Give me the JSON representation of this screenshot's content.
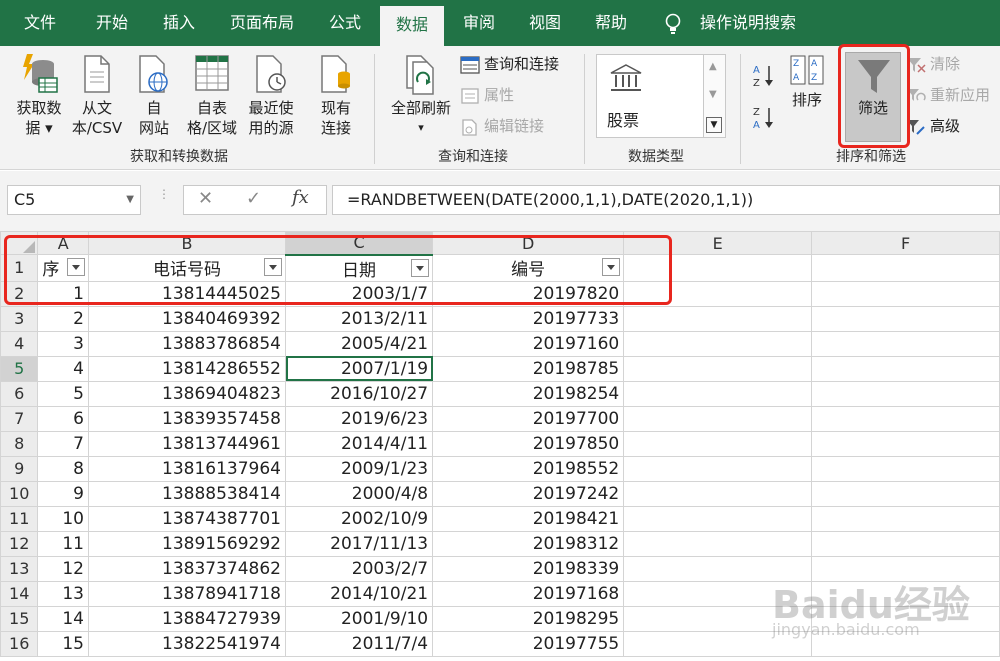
{
  "tabs": [
    {
      "label": "文件"
    },
    {
      "label": "开始"
    },
    {
      "label": "插入"
    },
    {
      "label": "页面布局"
    },
    {
      "label": "公式"
    },
    {
      "label": "数据"
    },
    {
      "label": "审阅"
    },
    {
      "label": "视图"
    },
    {
      "label": "帮助"
    },
    {
      "label": "操作说明搜索"
    }
  ],
  "active_tab": "数据",
  "ribbon": {
    "get_data": {
      "line1": "获取数",
      "line2": "据 ▾"
    },
    "from_csv": {
      "line1": "从文",
      "line2": "本/CSV"
    },
    "from_web": {
      "line1": "自",
      "line2": "网站"
    },
    "from_table": {
      "line1": "自表",
      "line2": "格/区域"
    },
    "recent_sources": {
      "line1": "最近使",
      "line2": "用的源"
    },
    "existing_conn": {
      "line1": "现有",
      "line2": "连接"
    },
    "group1_label": "获取和转换数据",
    "refresh_all": {
      "line1": "全部刷新",
      "line2": "▾"
    },
    "queries_connections": "查询和连接",
    "properties": "属性",
    "edit_links": "编辑链接",
    "group2_label": "查询和连接",
    "stocks": "股票",
    "group3_label": "数据类型",
    "sort": "排序",
    "filter": "筛选",
    "clear": "清除",
    "reapply": "重新应用",
    "advanced": "高级",
    "group4_label": "排序和筛选"
  },
  "formula_bar": {
    "name_box": "C5",
    "fx": "fx",
    "formula": "=RANDBETWEEN(DATE(2000,1,1),DATE(2020,1,1))"
  },
  "sheet": {
    "columns": [
      "A",
      "B",
      "C",
      "D",
      "E",
      "F"
    ],
    "header_row": {
      "a": "序",
      "b": "电话号码",
      "c": "日期",
      "d": "编号"
    },
    "rows": [
      {
        "n": "2",
        "a": "1",
        "b": "13814445025",
        "c": "2003/1/7",
        "d": "20197820"
      },
      {
        "n": "3",
        "a": "2",
        "b": "13840469392",
        "c": "2013/2/11",
        "d": "20197733"
      },
      {
        "n": "4",
        "a": "3",
        "b": "13883786854",
        "c": "2005/4/21",
        "d": "20197160"
      },
      {
        "n": "5",
        "a": "4",
        "b": "13814286552",
        "c": "2007/1/19",
        "d": "20198785"
      },
      {
        "n": "6",
        "a": "5",
        "b": "13869404823",
        "c": "2016/10/27",
        "d": "20198254"
      },
      {
        "n": "7",
        "a": "6",
        "b": "13839357458",
        "c": "2019/6/23",
        "d": "20197700"
      },
      {
        "n": "8",
        "a": "7",
        "b": "13813744961",
        "c": "2014/4/11",
        "d": "20197850"
      },
      {
        "n": "9",
        "a": "8",
        "b": "13816137964",
        "c": "2009/1/23",
        "d": "20198552"
      },
      {
        "n": "10",
        "a": "9",
        "b": "13888538414",
        "c": "2000/4/8",
        "d": "20197242"
      },
      {
        "n": "11",
        "a": "10",
        "b": "13874387701",
        "c": "2002/10/9",
        "d": "20198421"
      },
      {
        "n": "12",
        "a": "11",
        "b": "13891569292",
        "c": "2017/11/13",
        "d": "20198312"
      },
      {
        "n": "13",
        "a": "12",
        "b": "13837374862",
        "c": "2003/2/7",
        "d": "20198339"
      },
      {
        "n": "14",
        "a": "13",
        "b": "13878941718",
        "c": "2014/10/21",
        "d": "20197168"
      },
      {
        "n": "15",
        "a": "14",
        "b": "13884727939",
        "c": "2001/9/10",
        "d": "20198295"
      },
      {
        "n": "16",
        "a": "15",
        "b": "13822541974",
        "c": "2011/7/4",
        "d": "20197755"
      }
    ]
  },
  "watermark": {
    "main": "Baidu经验",
    "sub": "jingyan.baidu.com"
  },
  "colors": {
    "brand": "#217346",
    "highlight": "#e8261e"
  }
}
